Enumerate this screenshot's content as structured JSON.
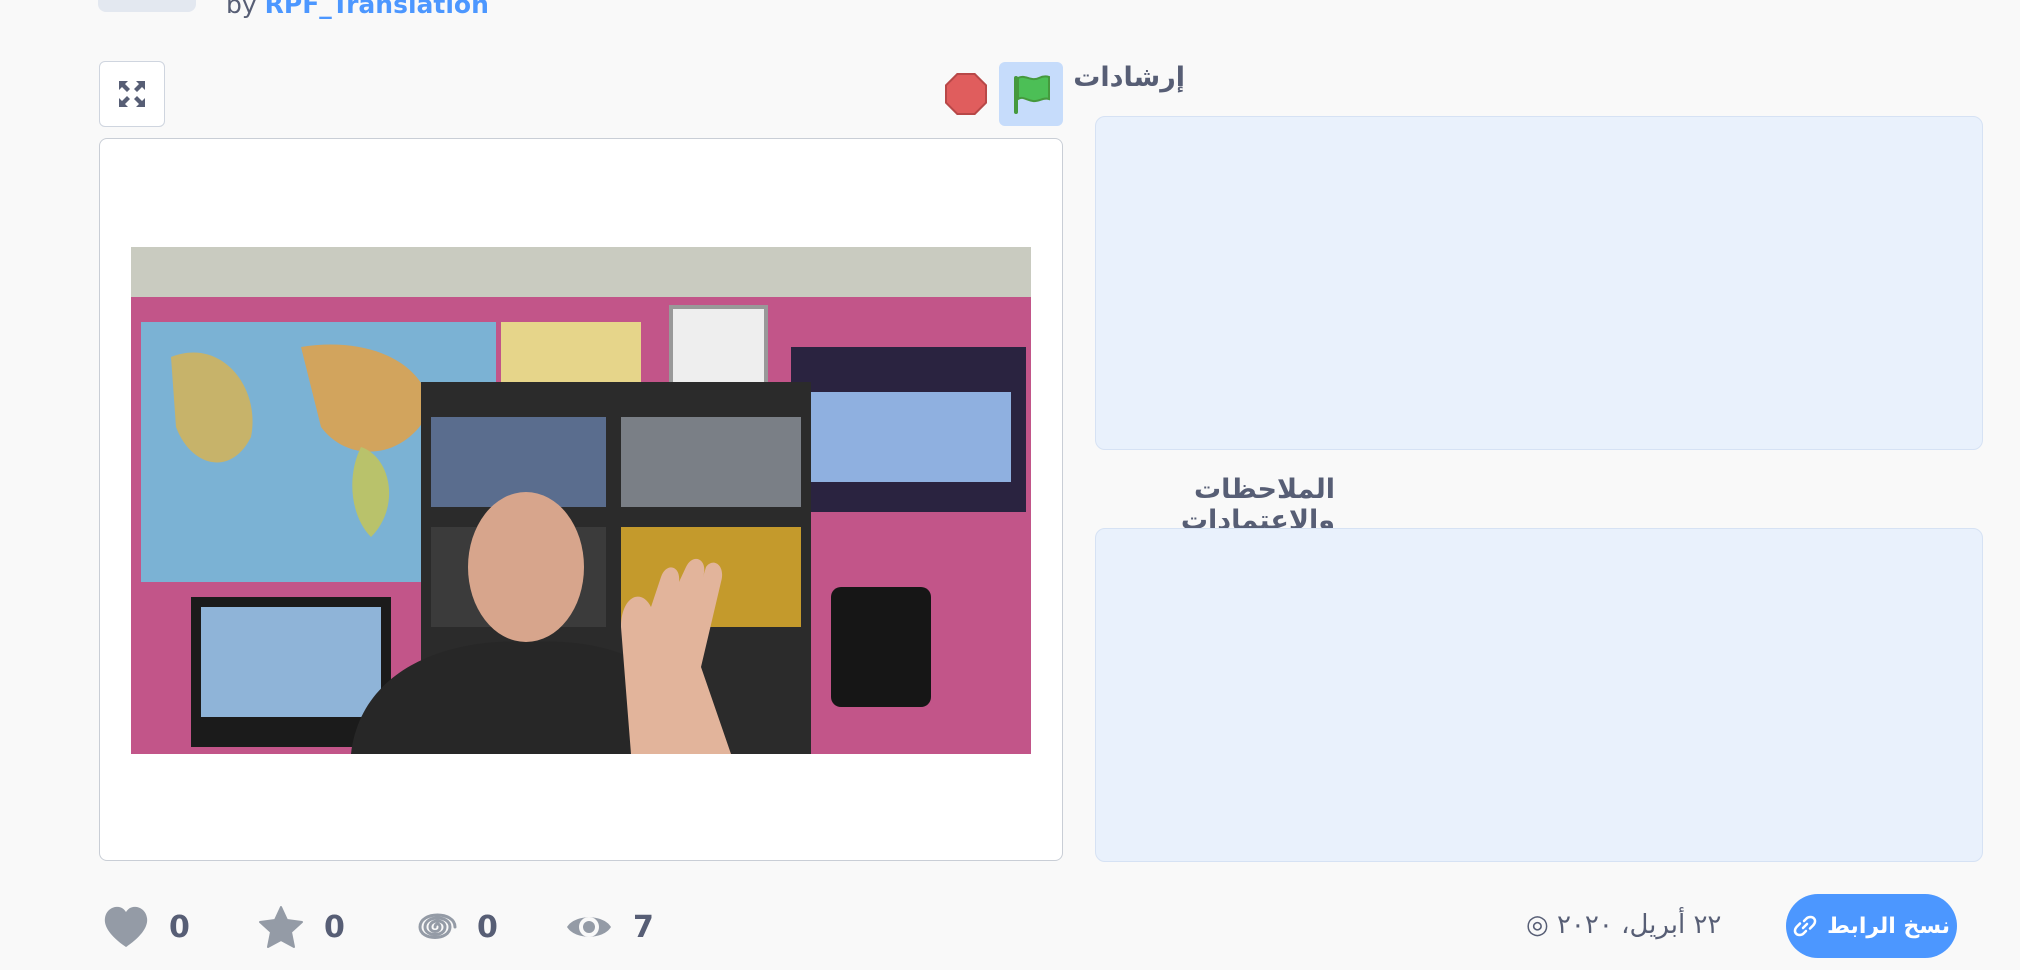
{
  "header": {
    "by_prefix": "by",
    "author": "RPF_Translation"
  },
  "stage_controls": {
    "fullscreen_icon": "fullscreen-icon",
    "stop_icon": "stop-icon",
    "green_flag_icon": "green-flag-icon"
  },
  "panel": {
    "instructions_label": "إرشادات",
    "notes_label": "الملاحظات والإعتمادات"
  },
  "stats": {
    "loves": "0",
    "favorites": "0",
    "remixes": "0",
    "views": "7"
  },
  "footer": {
    "date": "٢٢ أبريل، ٢٠٢٠",
    "copy_link": "نسخ الرابط"
  },
  "colors": {
    "accent": "#4c97ff",
    "text": "#575e75",
    "flag_bg": "#c6dcfb",
    "stop_red": "#e05d5d",
    "panel_bg": "#e9f1fc"
  }
}
